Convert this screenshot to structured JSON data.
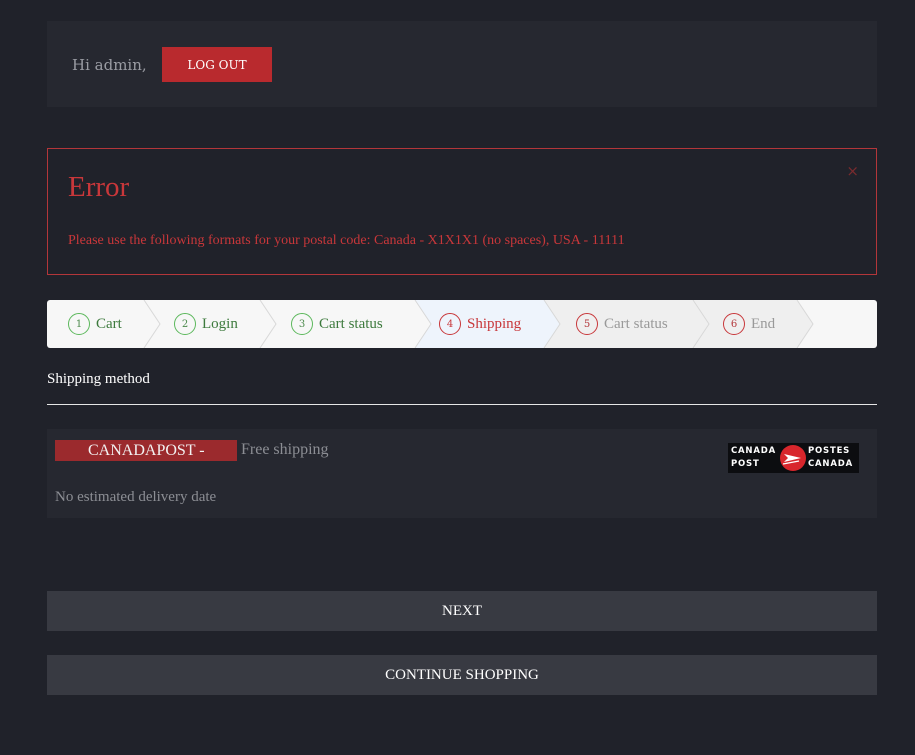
{
  "header": {
    "greeting": "Hi admin,",
    "logout_label": "LOG OUT"
  },
  "error": {
    "title": "Error",
    "message": "Please use the following formats for your postal code: Canada - X1X1X1 (no spaces), USA - 11111",
    "close_icon": "×"
  },
  "steps": [
    {
      "num": "1",
      "label": "Cart",
      "state": "done"
    },
    {
      "num": "2",
      "label": "Login",
      "state": "done"
    },
    {
      "num": "3",
      "label": "Cart status",
      "state": "done"
    },
    {
      "num": "4",
      "label": "Shipping",
      "state": "current"
    },
    {
      "num": "5",
      "label": "Cart status",
      "state": "todo"
    },
    {
      "num": "6",
      "label": "End",
      "state": "todo"
    }
  ],
  "shipping": {
    "section_title": "Shipping method",
    "carrier_label": "CANADAPOST -",
    "price_label": "Free shipping",
    "delivery_text": "No estimated delivery date",
    "logo": {
      "line1_left": "CANADA",
      "line1_right": "POSTES",
      "line2_left": "POST",
      "line2_right": "CANADA"
    }
  },
  "actions": {
    "next_label": "NEXT",
    "continue_label": "CONTINUE SHOPPING"
  },
  "colors": {
    "background": "#20222a",
    "panel": "#262830",
    "accent_red": "#b92a2e",
    "step_done_green": "#5cb85c",
    "button_gray": "#383a42"
  }
}
